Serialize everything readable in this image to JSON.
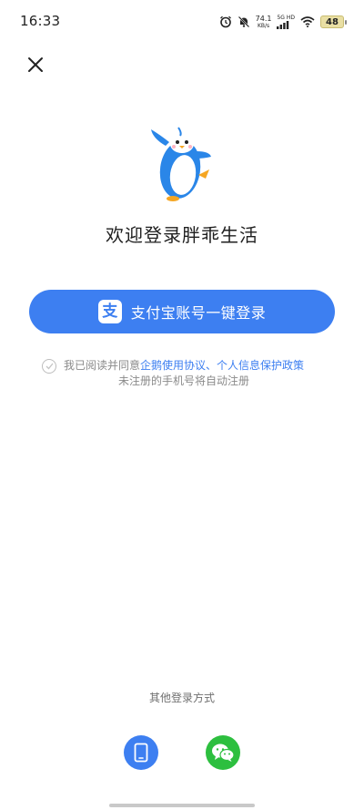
{
  "status_bar": {
    "time": "16:33",
    "net_speed": "74.1",
    "net_speed_unit": "KB/s",
    "net_type": "5G HD",
    "battery": "48",
    "icons": [
      "alarm-icon",
      "mute-icon",
      "signal-icon",
      "wifi-icon",
      "battery-icon"
    ]
  },
  "header": {
    "close_icon": "close-icon"
  },
  "brand": {
    "mascot": "penguin-mascot-icon",
    "welcome": "欢迎登录胖乖生活"
  },
  "login": {
    "alipay_label": "支付宝账号一键登录",
    "alipay_icon": "alipay-icon",
    "alipay_logo_char": "支"
  },
  "agreement": {
    "prefix": "我已阅读并同意",
    "link_terms": "企鹅使用协议",
    "separator": "、",
    "link_privacy": "个人信息保护政策",
    "note": "未注册的手机号将自动注册"
  },
  "other": {
    "title": "其他登录方式",
    "phone_icon": "phone-icon",
    "wechat_icon": "wechat-icon"
  },
  "colors": {
    "primary": "#3d7ff1",
    "wechat": "#2dbf3f",
    "text": "#1f1f1f",
    "muted": "#8a8a8a"
  }
}
